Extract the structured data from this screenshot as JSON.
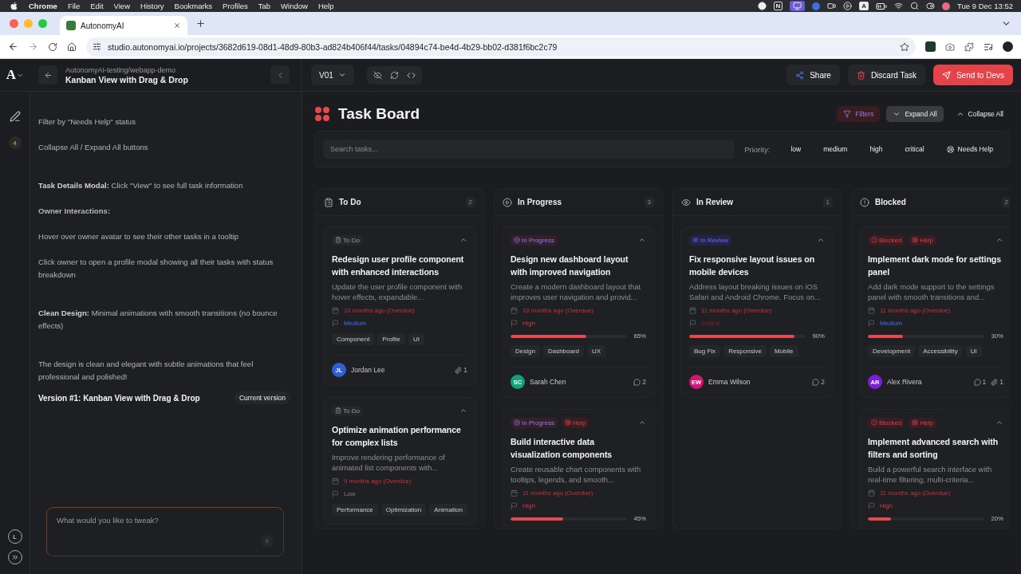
{
  "menubar": {
    "app": "Chrome",
    "menus": [
      "File",
      "Edit",
      "View",
      "History",
      "Bookmarks",
      "Profiles",
      "Tab",
      "Window",
      "Help"
    ],
    "tray": [
      {
        "kind": "record"
      },
      {
        "kind": "letter",
        "text": "N"
      },
      {
        "kind": "screen",
        "selected": true
      },
      {
        "kind": "meeting"
      },
      {
        "kind": "display"
      },
      {
        "kind": "play"
      },
      {
        "kind": "letter",
        "text": "A"
      },
      {
        "kind": "battery"
      },
      {
        "kind": "wifi"
      },
      {
        "kind": "search"
      },
      {
        "kind": "control"
      },
      {
        "kind": "avatar"
      }
    ],
    "clock": "Tue 9 Dec  13:52"
  },
  "browser": {
    "tab_title": "AutonomyAI",
    "url": "studio.autonomyai.io/projects/3682d619-08d1-48d9-80b3-ad824b406f44/tasks/04894c74-be4d-4b29-bb02-d381f6bc2c79"
  },
  "app_bar": {
    "logo": "A",
    "breadcrumb": "AutonomyAI-testing/webapp-demo",
    "title": "Kanban View with Drag & Drop",
    "version": "V01",
    "actions": [
      {
        "label": "Share",
        "kind": "share"
      },
      {
        "label": "Discard Task",
        "kind": "discard"
      },
      {
        "label": "Send to Devs",
        "kind": "send"
      }
    ]
  },
  "rail": {
    "badge": "4",
    "user": "L"
  },
  "chat": {
    "sections": [
      [
        {
          "text": "Filter by \"Needs Help\" status",
          "kind": "text"
        },
        {
          "text": "Collapse All / Expand All buttons",
          "kind": "text"
        }
      ],
      [
        {
          "text": "**Task Details Modal:** Click \"View\" to see full task information",
          "kind": "text"
        },
        {
          "text": "Owner Interactions:",
          "kind": "heading"
        },
        {
          "text": "Hover over owner avatar to see their other tasks in a tooltip",
          "kind": "text"
        },
        {
          "text": "Click owner to open a profile modal showing all their tasks with status breakdown",
          "kind": "text"
        }
      ],
      [
        {
          "text": "**Clean Design:** Minimal animations with smooth transitions (no bounce effects)",
          "kind": "text"
        }
      ],
      [
        {
          "text": "The design is clean and elegant with subtle animations that feel professional and polished!",
          "kind": "text"
        }
      ]
    ],
    "version": {
      "label": "Version #1: Kanban View with Drag & Drop",
      "badge": "Current version"
    },
    "input": {
      "placeholder": "What would you like to tweak?"
    }
  },
  "board": {
    "title": "Task Board",
    "tools": [
      {
        "label": "Filters",
        "kind": "filters"
      },
      {
        "label": "Expand All",
        "kind": "expand"
      },
      {
        "label": "Collapse All",
        "kind": "collapse"
      }
    ],
    "search": {
      "placeholder": "Search tasks..."
    },
    "priority_label": "Priority:",
    "priority_filters": [
      {
        "label": "low",
        "selected": false
      },
      {
        "label": "medium",
        "selected": false
      },
      {
        "label": "high",
        "selected": false
      },
      {
        "label": "critical",
        "selected": false
      }
    ],
    "needs_help": {
      "label": "Needs Help",
      "selected": false
    },
    "columns": [
      {
        "title": "To Do",
        "kind": "todo",
        "count": "2",
        "cards": [
          {
            "status": "To Do",
            "expanded": true,
            "title": "Redesign user profile component with enhanced interactions",
            "description": "Update the user profile component with hover effects, expandable...",
            "due": "10 months ago (Overdue)",
            "priority": {
              "label": "Medium",
              "kind": "medium"
            },
            "tags": [
              "Component",
              "Profile",
              "UI"
            ],
            "owner": {
              "initials": "JL",
              "name": "Jordan Lee",
              "color": "#2f5fd6"
            },
            "links": "1"
          },
          {
            "status": "To Do",
            "expanded": true,
            "title": "Optimize animation performance for complex lists",
            "description": "Improve rendering performance of animated list components with...",
            "due": "9 months ago (Overdue)",
            "priority": {
              "label": "Low",
              "kind": "low"
            },
            "tags": [
              "Performance",
              "Optimization",
              "Animation"
            ]
          }
        ]
      },
      {
        "title": "In Progress",
        "kind": "in_progress",
        "count": "3",
        "cards": [
          {
            "status": "In Progress",
            "expanded": true,
            "title": "Design new dashboard layout with improved navigation",
            "description": "Create a modern dashboard layout that improves user navigation and provid...",
            "due": "10 months ago (Overdue)",
            "priority": {
              "label": "High",
              "kind": "high"
            },
            "progress": {
              "level": 0.65,
              "reading": "65%"
            },
            "tags": [
              "Design",
              "Dashboard",
              "UX"
            ],
            "owner": {
              "initials": "SC",
              "name": "Sarah Chen",
              "color": "#12a37a"
            },
            "comments": "2"
          },
          {
            "status": "In Progress",
            "help": "Help",
            "expanded": true,
            "title": "Build interactive data visualization components",
            "description": "Create reusable chart components with tooltips, legends, and smooth...",
            "due": "11 months ago (Overdue)",
            "priority": {
              "label": "High",
              "kind": "high"
            },
            "progress": {
              "level": 0.45,
              "reading": "45%"
            }
          }
        ]
      },
      {
        "title": "In Review",
        "kind": "in_review",
        "count": "1",
        "cards": [
          {
            "status": "In Review",
            "expanded": true,
            "title": "Fix responsive layout issues on mobile devices",
            "description": "Address layout breaking issues on iOS Safari and Android Chrome. Focus on...",
            "due": "11 months ago (Overdue)",
            "priority": {
              "label": "Critical",
              "kind": "critical"
            },
            "progress": {
              "level": 0.9,
              "reading": "90%"
            },
            "tags": [
              "Bug Fix",
              "Responsive",
              "Mobile"
            ],
            "owner": {
              "initials": "EW",
              "name": "Emma Wilson",
              "color": "#d4146e"
            },
            "comments": "2"
          }
        ]
      },
      {
        "title": "Blocked",
        "kind": "blocked",
        "count": "2",
        "cards": [
          {
            "status": "Blocked",
            "help": "Help",
            "expanded": true,
            "title": "Implement dark mode for settings panel",
            "description": "Add dark mode support to the settings panel with smooth transitions and...",
            "due": "11 months ago (Overdue)",
            "priority": {
              "label": "Medium",
              "kind": "medium"
            },
            "progress": {
              "level": 0.3,
              "reading": "30%"
            },
            "tags": [
              "Development",
              "Accessibility",
              "UI"
            ],
            "owner": {
              "initials": "AR",
              "name": "Alex Rivera",
              "color": "#7b1fd8"
            },
            "comments": "1",
            "links": "1"
          },
          {
            "status": "Blocked",
            "help": "Help",
            "expanded": true,
            "title": "Implement advanced search with filters and sorting",
            "description": "Build a powerful search interface with real-time filtering, multi-criteria...",
            "due": "11 months ago (Overdue)",
            "priority": {
              "label": "High",
              "kind": "high"
            },
            "progress": {
              "level": 0.2,
              "reading": "20%"
            }
          }
        ]
      }
    ]
  }
}
